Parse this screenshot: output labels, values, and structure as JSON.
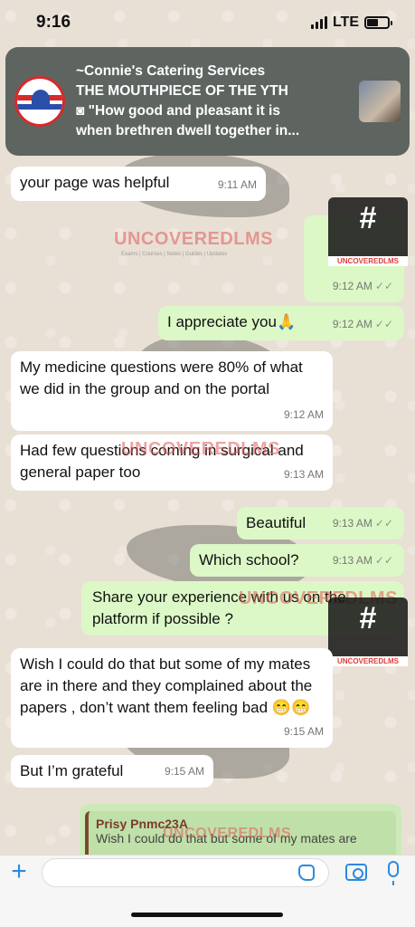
{
  "status_bar": {
    "time": "9:16",
    "network": "LTE"
  },
  "notification": {
    "sender": "~Connie's Catering Services",
    "group": "THE MOUTHPIECE OF THE YTH",
    "preview_line1": "\"How good and pleasant it is",
    "preview_line2": "when brethren dwell together in..."
  },
  "watermark": {
    "brand": "UNCOVEREDLMS",
    "tagline": "Exams | Courses | Notes | Guides | Updates"
  },
  "messages": [
    {
      "direction": "in",
      "text": "your page was helpful",
      "time": "9:11 AM"
    },
    {
      "direction": "out",
      "text": "",
      "time": "9:12 AM"
    },
    {
      "direction": "out",
      "text": "I appreciate you🙏",
      "time": "9:12 AM"
    },
    {
      "direction": "in",
      "text": "My medicine questions were 80% of what we did in the group and on the portal",
      "time": "9:12 AM"
    },
    {
      "direction": "in",
      "text": "Had few questions coming in surgical and general paper too",
      "time": "9:13 AM"
    },
    {
      "direction": "out",
      "text": "Beautiful",
      "time": "9:13 AM"
    },
    {
      "direction": "out",
      "text": "Which school?",
      "time": "9:13 AM"
    },
    {
      "direction": "out",
      "text": "Share your experience with us on the platform if possible ?",
      "time": ""
    },
    {
      "direction": "in",
      "text": "Wish I could do that but some of my mates are in there and  they complained about the papers , don’t want them feeling bad 😁😁",
      "time": "9:15 AM"
    },
    {
      "direction": "in",
      "text": "But I’m grateful",
      "time": "9:15 AM"
    }
  ],
  "reply_preview": {
    "name": "Prisy Pnmc23A",
    "text": "Wish I could do that but some of my mates are"
  },
  "input_bar": {
    "placeholder": ""
  },
  "icons": {
    "plus": "plus-icon",
    "sticker": "sticker-icon",
    "camera": "camera-icon",
    "mic": "mic-icon"
  },
  "colors": {
    "incoming": "#ffffff",
    "outgoing": "#dcf8c6",
    "accent": "#2a8ae0",
    "watermark": "#e05a5a"
  }
}
